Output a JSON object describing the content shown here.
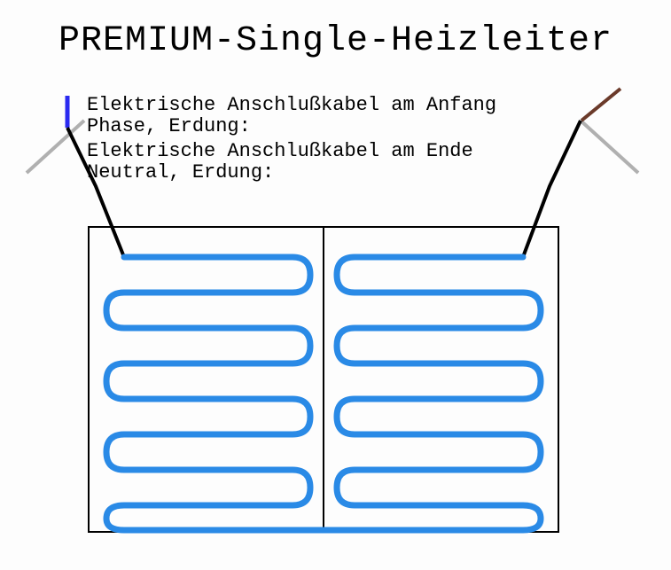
{
  "title": "PREMIUM-Single-Heizleiter",
  "labels": {
    "start_line1": "Elektrische Anschlußkabel am Anfang",
    "start_line2": "Phase, Erdung:",
    "end_line1": "Elektrische Anschlußkabel am Ende",
    "end_line2": "Neutral, Erdung:"
  },
  "colors": {
    "heating_cable": "#2a8ae6",
    "lead_black": "#000000",
    "lead_gray": "#b0b0b0",
    "lead_blue": "#2a2af0",
    "lead_brown": "#6b3a2a",
    "box": "#000000"
  }
}
